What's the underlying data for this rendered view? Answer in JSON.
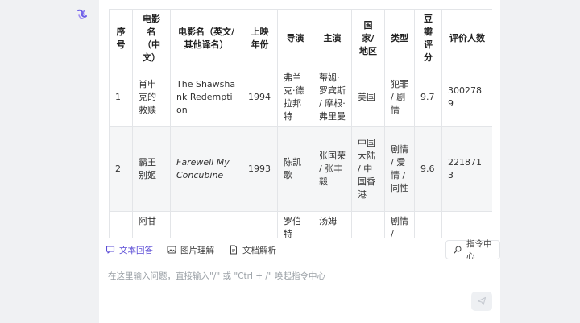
{
  "table": {
    "headers": [
      "序号",
      "电影名（中文）",
      "电影名（英文/其他译名）",
      "上映年份",
      "导演",
      "主演",
      "国家/地区",
      "类型",
      "豆瓣评分",
      "评价人数"
    ],
    "rows": [
      [
        "1",
        "肖申克的救赎",
        "The Shawshank Redemption",
        "1994",
        "弗兰克·德拉邦特",
        "蒂姆·罗宾斯 / 摩根·弗里曼",
        "美国",
        "犯罪 / 剧情",
        "9.7",
        "3002789"
      ],
      [
        "2",
        "霸王别姬",
        "Farewell My Concubine",
        "1993",
        "陈凯歌",
        "张国荣 / 张丰毅",
        "中国大陆 / 中国香港",
        "剧情 / 爱情 / 同性",
        "9.6",
        "2218713"
      ],
      [
        "",
        "阿甘",
        "",
        "",
        "罗伯特",
        "汤姆",
        "",
        "剧情 /",
        "",
        ""
      ]
    ]
  },
  "tools": {
    "text_answer": "文本回答",
    "image_understanding": "图片理解",
    "doc_parsing": "文档解析",
    "command_center": "指令中心"
  },
  "input": {
    "placeholder": "在这里输入问题，直接输入\"/\" 或 \"Ctrl + /\" 唤起指令中心"
  },
  "colors": {
    "accent": "#5a4bd6",
    "row_alt": "#f5f6f7",
    "border": "#e3e5e8"
  }
}
